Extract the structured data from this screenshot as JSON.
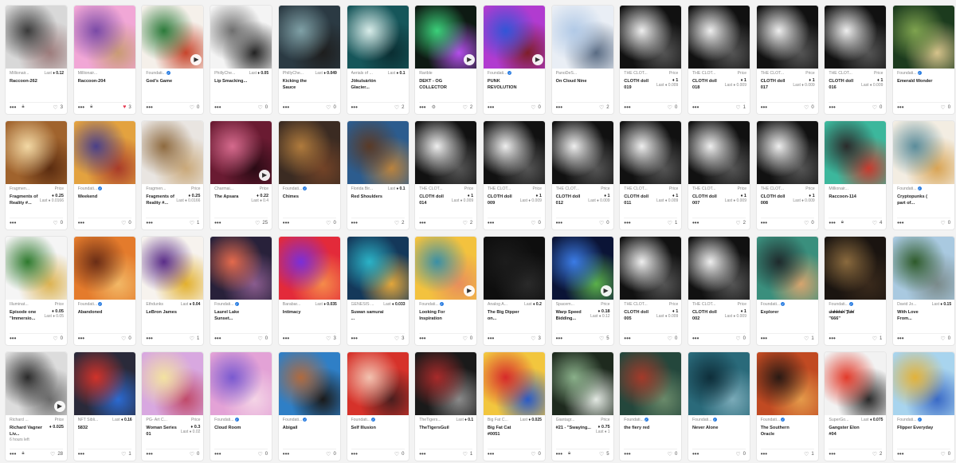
{
  "play_icon": "play-icon",
  "more_icon": "more-dots-icon",
  "heart_icon": "heart-icon",
  "cards": [
    {
      "collection": "Millionair...",
      "price_mode": "inline",
      "last_label": "Last",
      "price": "0.12",
      "title": "Raccoon-262",
      "likes": "3",
      "icons": [
        "lock"
      ],
      "colors": [
        "#d8d8d8",
        "#3a3a3a",
        "#9c7b7b"
      ],
      "video": false,
      "liked": false
    },
    {
      "collection": "Millionair...",
      "price_mode": "none",
      "title": "Raccoon-204",
      "likes": "3",
      "icons": [
        "lock"
      ],
      "colors": [
        "#f1a7d6",
        "#7a4aa6",
        "#c99b74"
      ],
      "video": false,
      "liked": true
    },
    {
      "collection": "Foundati...",
      "verified": true,
      "price_mode": "none",
      "title": "God's Game",
      "likes": "0",
      "icons": [],
      "colors": [
        "#f5f0ea",
        "#2c7a3a",
        "#c7452c"
      ],
      "video": true,
      "liked": false
    },
    {
      "collection": "PhillyChe...",
      "price_mode": "inline",
      "last_label": "Last",
      "price": "0.05",
      "title": "Lip Smacking...",
      "likes": "0",
      "icons": [],
      "colors": [
        "#f4f4f4",
        "#6e6e6e",
        "#222"
      ],
      "video": false,
      "liked": false
    },
    {
      "collection": "PhillyChe...",
      "price_mode": "inline",
      "last_label": "Last",
      "price": "0.049",
      "title": "Kicking the Sauce",
      "likes": "0",
      "icons": [],
      "colors": [
        "#2b3a43",
        "#7fa0a6",
        "#1e1e1e"
      ],
      "video": false,
      "liked": false
    },
    {
      "collection": "Aerials of ...",
      "price_mode": "inline",
      "last_label": "Last",
      "price": "0.1",
      "title": "Jökulsárlón Glacier...",
      "likes": "2",
      "icons": [],
      "colors": [
        "#16565a",
        "#d8ece9",
        "#0a2e32"
      ],
      "video": false,
      "liked": false
    },
    {
      "collection": "Rarible",
      "price_mode": "none",
      "title": "DEKT - OG COLLECTOR",
      "likes": "2",
      "icons": [
        "gear"
      ],
      "colors": [
        "#0e1a13",
        "#3bd07a",
        "#b34eea"
      ],
      "video": true,
      "liked": false
    },
    {
      "collection": "Foundati...",
      "verified": true,
      "price_mode": "none",
      "title": "PUNK REVOLUTION",
      "likes": "0",
      "icons": [],
      "colors": [
        "#b13bd0",
        "#3255d6",
        "#7e1e2a"
      ],
      "video": true,
      "liked": false
    },
    {
      "collection": "PanoDeS...",
      "price_mode": "none",
      "title": "On Cloud Nine",
      "likes": "2",
      "icons": [],
      "colors": [
        "#e9eef5",
        "#b1c9e6",
        "#5a6c84"
      ],
      "video": false,
      "liked": false
    },
    {
      "collection": "THE CLOT...",
      "price_mode": "stack",
      "price_label": "Price",
      "price": "1",
      "last_label": "Last",
      "last_price": "0.009",
      "title": "CLOTH doll 019",
      "likes": "0",
      "icons": [],
      "colors": [
        "#111",
        "#eee",
        "#555"
      ],
      "video": false,
      "liked": false
    },
    {
      "collection": "THE CLOT...",
      "price_mode": "stack",
      "price_label": "Price",
      "price": "1",
      "last_label": "Last",
      "last_price": "0.009",
      "title": "CLOTH doll 018",
      "likes": "1",
      "icons": [],
      "colors": [
        "#111",
        "#eee",
        "#555"
      ],
      "video": false,
      "liked": false
    },
    {
      "collection": "THE CLOT...",
      "price_mode": "stack",
      "price_label": "Price",
      "price": "1",
      "last_label": "Last",
      "last_price": "0.009",
      "title": "CLOTH doll 017",
      "likes": "0",
      "icons": [],
      "colors": [
        "#111",
        "#eee",
        "#555"
      ],
      "video": false,
      "liked": false
    },
    {
      "collection": "THE CLOT...",
      "price_mode": "stack",
      "price_label": "Price",
      "price": "1",
      "last_label": "Last",
      "last_price": "0.009",
      "title": "CLOTH doll 016",
      "likes": "0",
      "icons": [],
      "colors": [
        "#111",
        "#eee",
        "#555"
      ],
      "video": false,
      "liked": false
    },
    {
      "collection": "Foundati...",
      "verified": true,
      "price_mode": "none",
      "title": "Emerald Wonder",
      "likes": "0",
      "icons": [],
      "colors": [
        "#1c3b1e",
        "#7fa34f",
        "#d6c38b"
      ],
      "video": false,
      "liked": false
    },
    {
      "collection": "Fragmen...",
      "price_mode": "stack",
      "price_label": "Price",
      "price": "0.25",
      "title": "Fragments of Reality #...",
      "last_label": "Last",
      "last_price": "0.0166",
      "likes": "0",
      "icons": [],
      "colors": [
        "#a0632d",
        "#f2d8a4",
        "#5b2c10"
      ],
      "video": false,
      "liked": false
    },
    {
      "collection": "Foundati...",
      "verified": true,
      "price_mode": "none",
      "title": "Weekend",
      "likes": "0",
      "icons": [],
      "colors": [
        "#e3a23f",
        "#4a3f88",
        "#a83b29"
      ],
      "video": false,
      "liked": false
    },
    {
      "collection": "Fragmen...",
      "price_mode": "stack",
      "price_label": "Price",
      "price": "0.25",
      "title": "Fragments of Reality #...",
      "last_label": "Last",
      "last_price": "0.0166",
      "likes": "1",
      "icons": [],
      "colors": [
        "#e9e5e1",
        "#8e6a3f",
        "#c9a879"
      ],
      "video": false,
      "liked": false
    },
    {
      "collection": "Charmai...",
      "price_mode": "stack",
      "price_label": "Price",
      "price": "0.22",
      "title": "The Apsara",
      "last_label": "Last",
      "last_price": "0.4",
      "likes": "25",
      "icons": [],
      "colors": [
        "#6a1b32",
        "#d56a8d",
        "#2a0a14"
      ],
      "video": true,
      "liked": false
    },
    {
      "collection": "Foundati...",
      "verified": true,
      "price_mode": "none",
      "title": "Chimes",
      "likes": "0",
      "icons": [],
      "colors": [
        "#3b2b22",
        "#b07b3d",
        "#734327"
      ],
      "video": false,
      "liked": false
    },
    {
      "collection": "Florida Bir...",
      "price_mode": "inline",
      "last_label": "Last",
      "price": "0.1",
      "title": "Red Shoulders",
      "likes": "2",
      "icons": [],
      "colors": [
        "#2c5c8e",
        "#5a3a26",
        "#b9823e"
      ],
      "video": false,
      "liked": false
    },
    {
      "collection": "THE CLOT...",
      "price_mode": "stack",
      "price_label": "Price",
      "price": "1",
      "last_label": "Last",
      "last_price": "0.009",
      "title": "CLOTH doll 014",
      "likes": "2",
      "icons": [],
      "colors": [
        "#111",
        "#eee",
        "#555"
      ],
      "video": false,
      "liked": false
    },
    {
      "collection": "THE CLOT...",
      "price_mode": "stack",
      "price_label": "Price",
      "price": "1",
      "last_label": "Last",
      "last_price": "0.009",
      "title": "CLOTH doll 009",
      "likes": "0",
      "icons": [],
      "colors": [
        "#111",
        "#eee",
        "#555"
      ],
      "video": false,
      "liked": false
    },
    {
      "collection": "THE CLOT...",
      "price_mode": "stack",
      "price_label": "Price",
      "price": "1",
      "last_label": "Last",
      "last_price": "0.009",
      "title": "CLOTH doll 012",
      "likes": "0",
      "icons": [],
      "colors": [
        "#111",
        "#eee",
        "#555"
      ],
      "video": false,
      "liked": false
    },
    {
      "collection": "THE CLOT...",
      "price_mode": "stack",
      "price_label": "Price",
      "price": "1",
      "last_label": "Last",
      "last_price": "0.009",
      "title": "CLOTH doll 011",
      "likes": "1",
      "icons": [],
      "colors": [
        "#111",
        "#eee",
        "#555"
      ],
      "video": false,
      "liked": false
    },
    {
      "collection": "THE CLOT...",
      "price_mode": "stack",
      "price_label": "Price",
      "price": "1",
      "last_label": "Last",
      "last_price": "0.009",
      "title": "CLOTH doll 007",
      "likes": "2",
      "icons": [],
      "colors": [
        "#111",
        "#eee",
        "#555"
      ],
      "video": false,
      "liked": false
    },
    {
      "collection": "THE CLOT...",
      "price_mode": "stack",
      "price_label": "Price",
      "price": "1",
      "last_label": "Last",
      "last_price": "0.009",
      "title": "CLOTH doll 008",
      "likes": "0",
      "icons": [],
      "colors": [
        "#111",
        "#eee",
        "#555"
      ],
      "video": false,
      "liked": false
    },
    {
      "collection": "Millionair...",
      "price_mode": "none",
      "title": "Raccoon-114",
      "likes": "4",
      "icons": [
        "lock"
      ],
      "colors": [
        "#3cb79c",
        "#2b2b2b",
        "#c73a2e"
      ],
      "video": false,
      "liked": false
    },
    {
      "collection": "Foundati...",
      "verified": true,
      "price_mode": "none",
      "title": "Cryptopunks ( part of...",
      "likes": "0",
      "icons": [],
      "colors": [
        "#f3ede2",
        "#5b8c9a",
        "#d8a455"
      ],
      "video": false,
      "liked": false
    },
    {
      "collection": "Illuminat...",
      "price_mode": "stack",
      "price_label": "Price",
      "price": "0.05",
      "title": "Episode one \"Immersio...",
      "last_label": "Last",
      "last_price": "0.05",
      "likes": "0",
      "icons": [],
      "colors": [
        "#f5f5f5",
        "#2f7a2e",
        "#dcb352"
      ],
      "video": false,
      "liked": false
    },
    {
      "collection": "Foundati...",
      "verified": true,
      "price_mode": "none",
      "title": "Abandoned",
      "likes": "0",
      "icons": [],
      "colors": [
        "#e47b2c",
        "#6a2d16",
        "#f2b866"
      ],
      "video": false,
      "liked": false
    },
    {
      "collection": "Ethdunks",
      "price_mode": "inline",
      "last_label": "Last",
      "price": "0.04",
      "title": "LeBron James",
      "likes": "1",
      "icons": [],
      "colors": [
        "#f7f3ee",
        "#5a2d88",
        "#e2b02e"
      ],
      "video": false,
      "liked": false
    },
    {
      "collection": "Foundati...",
      "verified": true,
      "price_mode": "none",
      "title": "Laurel Lake Sunset...",
      "likes": "0",
      "icons": [],
      "colors": [
        "#28213a",
        "#e46a4d",
        "#8a5c8e"
      ],
      "video": false,
      "liked": false
    },
    {
      "collection": "Barabar...",
      "price_mode": "inline",
      "last_label": "Last",
      "price": "0.035",
      "title": "Intimacy",
      "likes": "3",
      "icons": [],
      "colors": [
        "#e32a3a",
        "#7a2fd8",
        "#f58b4a"
      ],
      "video": false,
      "liked": false
    },
    {
      "collection": "GENESIS ...",
      "price_mode": "inline",
      "last_label": "Last",
      "price": "0.033",
      "title": "Suwan samurai ...",
      "likes": "3",
      "icons": [],
      "colors": [
        "#14385a",
        "#2bb3c7",
        "#e2a63b"
      ],
      "video": false,
      "liked": false
    },
    {
      "collection": "Foundati...",
      "verified": true,
      "price_mode": "none",
      "title": "Looking For Inspiration",
      "likes": "0",
      "icons": [],
      "colors": [
        "#f3c23e",
        "#3a8fa6",
        "#e88e5c"
      ],
      "video": true,
      "liked": false
    },
    {
      "collection": "Analog A...",
      "price_mode": "inline",
      "last_label": "Last",
      "price": "0.2",
      "title": "The Big Dipper on...",
      "likes": "3",
      "icons": [],
      "colors": [
        "#0e0e0e",
        "#1c1c1c",
        "#2a2a2a"
      ],
      "video": false,
      "liked": false
    },
    {
      "collection": "Spacem...",
      "price_mode": "stack",
      "price_label": "Price",
      "price": "0.18",
      "title": "Warp Speed Bidding...",
      "last_label": "Last",
      "last_price": "0.12",
      "likes": "5",
      "icons": [],
      "colors": [
        "#0b1436",
        "#3b7ce6",
        "#5ab04a"
      ],
      "video": true,
      "liked": false
    },
    {
      "collection": "THE CLOT...",
      "price_mode": "stack",
      "price_label": "Price",
      "price": "1",
      "last_label": "Last",
      "last_price": "0.009",
      "title": "CLOTH doll 005",
      "likes": "0",
      "icons": [],
      "colors": [
        "#111",
        "#eee",
        "#555"
      ],
      "video": false,
      "liked": false
    },
    {
      "collection": "THE CLOT...",
      "price_mode": "stack",
      "price_label": "Price",
      "price": "1",
      "last_label": "Last",
      "last_price": "0.009",
      "title": "CLOTH doll 002",
      "likes": "0",
      "icons": [],
      "colors": [
        "#111",
        "#eee",
        "#555"
      ],
      "video": false,
      "liked": false
    },
    {
      "collection": "Foundati...",
      "verified": true,
      "price_mode": "none",
      "title": "Explorer",
      "likes": "1",
      "icons": [],
      "colors": [
        "#3a8f7d",
        "#1f2a2c",
        "#d6a46e"
      ],
      "video": false,
      "liked": false
    },
    {
      "collection": "Foundati...",
      "verified": true,
      "price_mode": "none",
      "title": "ʟ̸ᴍ̸ʀ̸ᴋ̸ɴ̸ᴀ̸ Ṯ̸ᴜ̸ʀ̸ \"666\"",
      "likes": "1",
      "icons": [],
      "colors": [
        "#1a1410",
        "#8a6a3e",
        "#3a2a1c"
      ],
      "video": false,
      "liked": false
    },
    {
      "collection": "David Jo...",
      "price_mode": "inline",
      "last_label": "Last",
      "price": "0.15",
      "title": "With Love From...",
      "likes": "0",
      "icons": [],
      "colors": [
        "#a9c9e0",
        "#2e5a2a",
        "#7a8a8a"
      ],
      "video": false,
      "liked": false
    },
    {
      "collection": "Richard ...",
      "price_mode": "stack",
      "price_label": "Price",
      "price": "0.025",
      "title": "Richard Vagner Liv...",
      "extra": "6 hours left",
      "likes": "28",
      "icons": [
        "lock"
      ],
      "colors": [
        "#dcdcdc",
        "#2a2a2a",
        "#6a6a6a"
      ],
      "video": true,
      "liked": false
    },
    {
      "collection": "NFT Sibli...",
      "price_mode": "inline",
      "last_label": "Last",
      "price": "0.16",
      "title": "5832",
      "likes": "1",
      "icons": [],
      "colors": [
        "#2a2a3a",
        "#d1322a",
        "#2b6ad1"
      ],
      "video": false,
      "liked": false
    },
    {
      "collection": "PG- Art C...",
      "price_mode": "stack",
      "price_label": "Price",
      "price": "0.3",
      "title": "Woman Series 01",
      "last_label": "Last",
      "last_price": "0.02",
      "likes": "0",
      "icons": [],
      "colors": [
        "#d8a8e0",
        "#f3e2a0",
        "#c04a6a"
      ],
      "video": false,
      "liked": false
    },
    {
      "collection": "Foundati...",
      "verified": true,
      "price_mode": "none",
      "title": "Cloud Room",
      "likes": "0",
      "icons": [],
      "colors": [
        "#e3a2d6",
        "#7a5ad0",
        "#f4d4e6"
      ],
      "video": false,
      "liked": false
    },
    {
      "collection": "Foundati...",
      "verified": true,
      "price_mode": "none",
      "title": "Abigail",
      "likes": "0",
      "icons": [],
      "colors": [
        "#2f7fc6",
        "#b06a3e",
        "#1a1a1a"
      ],
      "video": false,
      "liked": false
    },
    {
      "collection": "Foundati...",
      "verified": true,
      "price_mode": "none",
      "title": "Self Illusion",
      "likes": "0",
      "icons": [],
      "colors": [
        "#d6322a",
        "#f2c2b0",
        "#4a1e1e"
      ],
      "video": false,
      "liked": false
    },
    {
      "collection": "TheTigers...",
      "price_mode": "inline",
      "last_label": "Last",
      "price": "0.1",
      "title": "TheTigersGuil",
      "likes": "1",
      "icons": [],
      "colors": [
        "#1a1a1a",
        "#a82a2a",
        "#8a8a8a"
      ],
      "video": false,
      "liked": false
    },
    {
      "collection": "Big Fat C...",
      "price_mode": "inline",
      "last_label": "Last",
      "price": "0.025",
      "title": "Big Fat Cat #0051",
      "likes": "0",
      "icons": [],
      "colors": [
        "#f2c63e",
        "#d62a2a",
        "#2a5ac6"
      ],
      "video": false,
      "liked": false
    },
    {
      "collection": "Giantagr...",
      "price_mode": "stack",
      "price_label": "Price",
      "price": "0.75",
      "title": "#21 - \"Swaying...",
      "last_label": "Last",
      "last_price": "1",
      "likes": "5",
      "icons": [
        "lock"
      ],
      "colors": [
        "#1e2a1e",
        "#8ab08a",
        "#e2e8e2"
      ],
      "video": false,
      "liked": false
    },
    {
      "collection": "Foundati...",
      "verified": true,
      "price_mode": "none",
      "title": "the fiery red",
      "likes": "0",
      "icons": [],
      "colors": [
        "#24473c",
        "#a43a2a",
        "#6a8a6a"
      ],
      "video": false,
      "liked": false
    },
    {
      "collection": "Foundati...",
      "verified": true,
      "price_mode": "none",
      "title": "Never Alone",
      "likes": "0",
      "icons": [],
      "colors": [
        "#2a6a7a",
        "#0e2e3a",
        "#7aaab8"
      ],
      "video": false,
      "liked": false
    },
    {
      "collection": "Foundati...",
      "verified": true,
      "price_mode": "none",
      "title": "The Southern Oracle",
      "likes": "1",
      "icons": [],
      "colors": [
        "#c14a22",
        "#2a1a14",
        "#e49a4a"
      ],
      "video": false,
      "liked": false
    },
    {
      "collection": "SuperGo...",
      "price_mode": "inline",
      "last_label": "Last",
      "price": "0.075",
      "title": "Gangster Elon #04",
      "likes": "2",
      "icons": [],
      "colors": [
        "#f2f2f2",
        "#e23a2a",
        "#2a2a2a"
      ],
      "video": false,
      "liked": false
    },
    {
      "collection": "Foundati...",
      "verified": true,
      "price_mode": "none",
      "title": "Flipper Everyday",
      "likes": "0",
      "icons": [],
      "colors": [
        "#a8d4ee",
        "#e2b23a",
        "#3a6ac6"
      ],
      "video": false,
      "liked": false
    }
  ]
}
